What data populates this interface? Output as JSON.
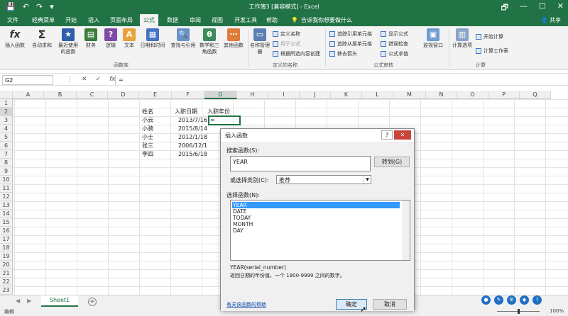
{
  "titlebar": {
    "title": "工作簿3 [兼容模式] - Excel",
    "qat": [
      "💾",
      "↶",
      "↷",
      "▾"
    ],
    "winbtns": [
      "🗗",
      "—",
      "☐",
      "✕"
    ]
  },
  "tabs": [
    "文件",
    "经典菜单",
    "开始",
    "插入",
    "页面布局",
    "公式",
    "数据",
    "审阅",
    "视图",
    "开发工具",
    "帮助"
  ],
  "active_tab": "公式",
  "tellme": "告诉我你想要做什么",
  "share": "共享",
  "ribbon": {
    "function_library": {
      "buttons": [
        "插入函数",
        "自动求和",
        "最近使用的函数",
        "财务",
        "逻辑",
        "文本",
        "日期和时间",
        "查找与引用",
        "数学和三角函数",
        "其他函数"
      ],
      "label": "函数库"
    },
    "defined_names": {
      "name_manager": "名称管理器",
      "items": [
        "定义名称",
        "用于公式",
        "根据所选内容创建"
      ],
      "label": "定义的名称"
    },
    "formula_auditing": {
      "items": [
        "追踪引用单元格",
        "显示公式",
        "追踪从属单元格",
        "错误检查",
        "移去箭头",
        "公式求值"
      ],
      "watch": "监视窗口",
      "label": "公式审核"
    },
    "calculation": {
      "options": "计算选项",
      "items": [
        "开始计算",
        "计算工作表"
      ],
      "label": "计算"
    }
  },
  "formula_bar": {
    "name_box": "G2",
    "icons": [
      "⋮",
      "✕",
      "✓",
      "fx"
    ],
    "formula": "="
  },
  "columns": [
    "A",
    "B",
    "C",
    "D",
    "E",
    "F",
    "G",
    "H",
    "I",
    "J",
    "K",
    "L",
    "M",
    "N",
    "O",
    "P",
    "Q"
  ],
  "rows": [
    "1",
    "2",
    "3",
    "4",
    "5",
    "6",
    "7",
    "8",
    "9",
    "10",
    "11",
    "12",
    "13",
    "14",
    "15",
    "16",
    "17",
    "18",
    "19",
    "20",
    "21",
    "22",
    "23"
  ],
  "sheet": {
    "headers": [
      "姓名",
      "入职日期",
      "入职年份"
    ],
    "names": [
      "小云",
      "小骑",
      "小士",
      "张三",
      "李四"
    ],
    "dates": [
      "2013/7/16",
      "2015/8/14",
      "2012/1/18",
      "2006/12/1",
      "2015/6/18"
    ],
    "g2": "="
  },
  "sheet_tab": "Sheet1",
  "status": {
    "mode": "编辑",
    "zoom": "100%",
    "zoom_level_percent": 100
  },
  "dialog": {
    "title": "插入函数",
    "help": "?",
    "close": "✕",
    "search_label": "搜索函数(S):",
    "search_value": "YEAR",
    "go": "转到(G)",
    "category_label": "或选择类别(C):",
    "category_value": "推荐",
    "list_label": "选择函数(N):",
    "functions": [
      "YEAR",
      "DATE",
      "TODAY",
      "MONTH",
      "DAY"
    ],
    "selected_function": "YEAR",
    "signature": "YEAR(serial_number)",
    "description": "返回日期的年份值，一个 1900-9999 之间的数字。",
    "help_link": "有关该函数的帮助",
    "ok": "确定",
    "cancel": "取消"
  }
}
